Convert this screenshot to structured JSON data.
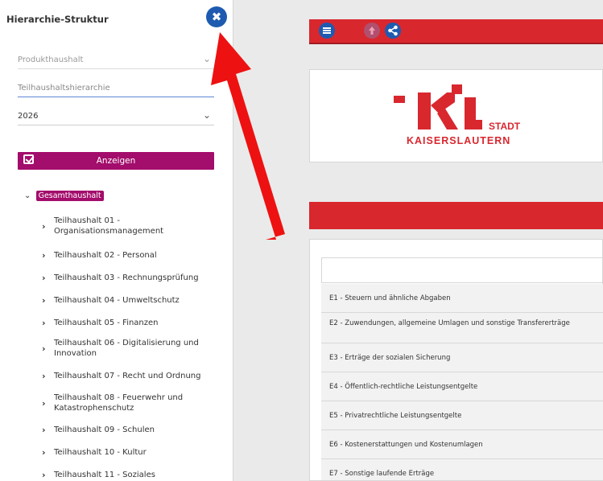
{
  "sidebar": {
    "title": "Hierarchie-Struktur",
    "close_icon": "✖",
    "fields": {
      "produkthaushalt_placeholder": "Produkthaushalt",
      "teilhaushalt_placeholder": "Teilhaushaltshierarchie",
      "year_value": "2026"
    },
    "show_button": "Anzeigen",
    "tree_root": "Gesamthaushalt",
    "tree_items": [
      "Teilhaushalt 01 - Organisationsmanagement",
      "Teilhaushalt 02 - Personal",
      "Teilhaushalt 03 - Rechnungsprüfung",
      "Teilhaushalt 04 - Umweltschutz",
      "Teilhaushalt 05 - Finanzen",
      "Teilhaushalt 06 - Digitalisierung und Innovation",
      "Teilhaushalt 07 - Recht und Ordnung",
      "Teilhaushalt 08 - Feuerwehr und Katastrophenschutz",
      "Teilhaushalt 09 - Schulen",
      "Teilhaushalt 10 - Kultur",
      "Teilhaushalt 11 - Soziales"
    ]
  },
  "logo": {
    "line1": "STADT",
    "line2": "KAISERSLAUTERN"
  },
  "table": {
    "rows": [
      "E1 - Steuern und ähnliche Abgaben",
      "E2 - Zuwendungen, allgemeine Umlagen und sonstige Transfererträge",
      "E3 - Erträge der sozialen Sicherung",
      "E4 - Öffentlich-rechtliche Leistungsentgelte",
      "E5 - Privatrechtliche Leistungsentgelte",
      "E6 - Kostenerstattungen und Kostenumlagen",
      "E7 - Sonstige laufende Erträge"
    ]
  },
  "colors": {
    "accent_red": "#d9272e",
    "accent_magenta": "#a30d6b",
    "accent_blue": "#1e5bb0"
  }
}
